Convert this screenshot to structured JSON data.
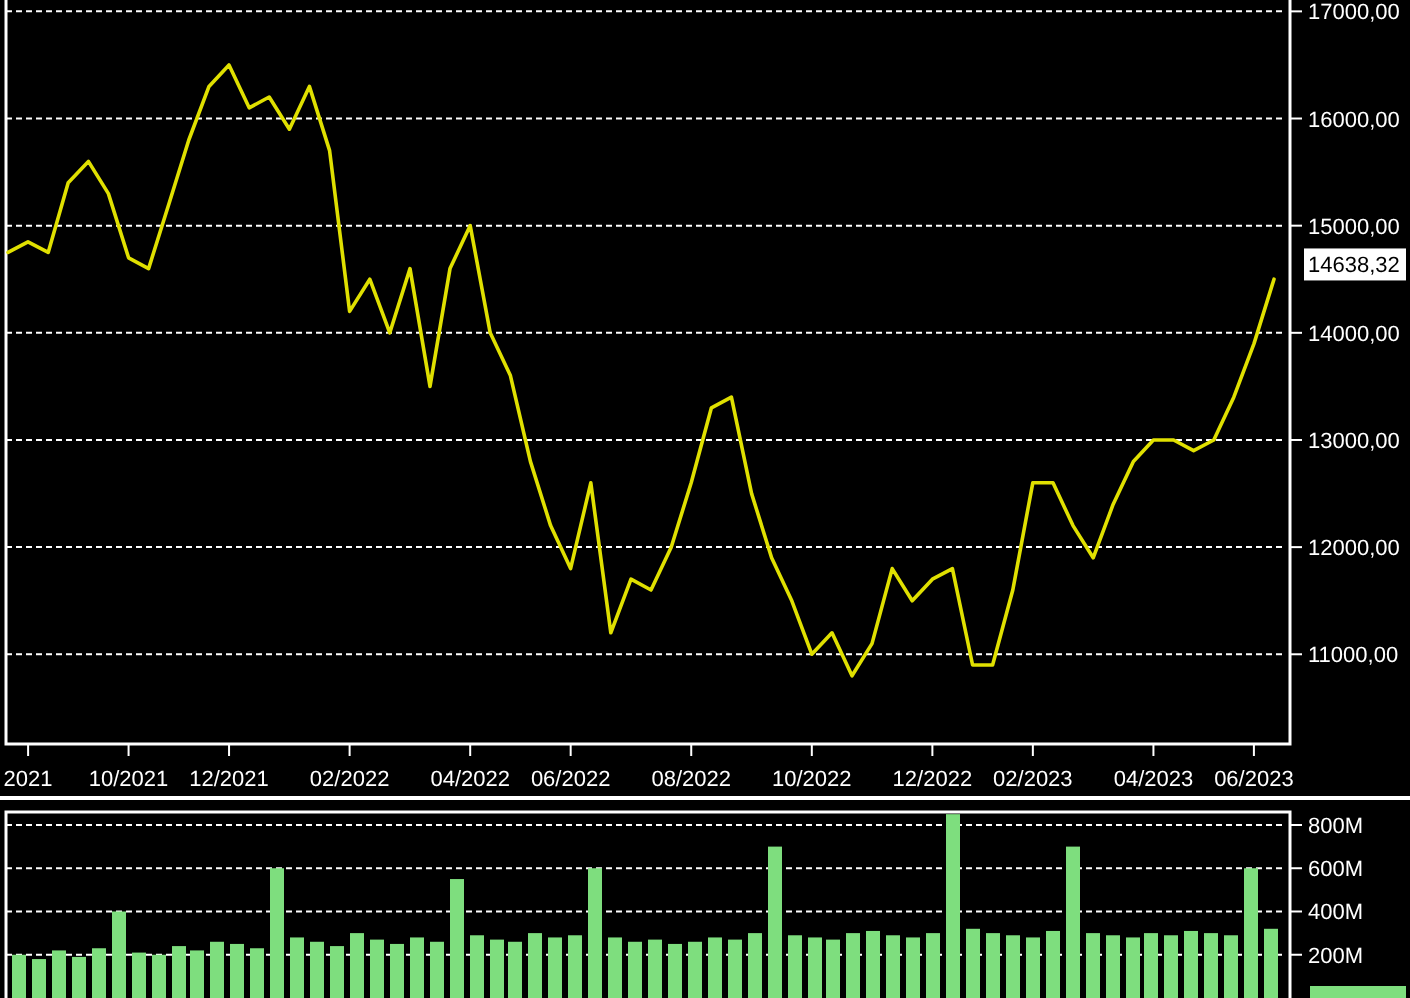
{
  "price_chart": {
    "chart_data": {
      "type": "line",
      "categories": [
        null,
        "2021",
        null,
        null,
        null,
        null,
        "10/2021",
        null,
        null,
        null,
        null,
        "12/2021",
        null,
        null,
        null,
        null,
        null,
        "02/2022",
        null,
        null,
        null,
        null,
        null,
        "04/2022",
        null,
        null,
        null,
        null,
        "06/2022",
        null,
        null,
        null,
        null,
        null,
        "08/2022",
        null,
        null,
        null,
        null,
        null,
        "10/2022",
        null,
        null,
        null,
        null,
        null,
        "12/2022",
        null,
        null,
        null,
        null,
        "02/2023",
        null,
        null,
        null,
        null,
        null,
        "04/2023",
        null,
        null,
        null,
        null,
        "06/2023",
        null
      ],
      "series": [
        {
          "color": "#e0e000",
          "values": [
            14750,
            14850,
            14750,
            15400,
            15600,
            15300,
            14700,
            14600,
            15200,
            15800,
            16300,
            16500,
            16100,
            16200,
            15900,
            16300,
            15700,
            14200,
            14500,
            14000,
            14600,
            13500,
            14600,
            15000,
            14000,
            13600,
            12800,
            12200,
            11800,
            12600,
            11200,
            11700,
            11600,
            12000,
            12600,
            13300,
            13400,
            12500,
            11900,
            11500,
            11000,
            11200,
            10800,
            11100,
            11800,
            11500,
            11700,
            11800,
            10900,
            10900,
            11600,
            12600,
            12600,
            12200,
            11900,
            12400,
            12800,
            13000,
            13000,
            12900,
            13000,
            13400,
            13900,
            14500
          ]
        }
      ],
      "ylim": [
        10200,
        17050
      ],
      "grid": true,
      "yticks": [
        {
          "value": 17000,
          "label": "17000,00"
        },
        {
          "value": 16000,
          "label": "16000,00"
        },
        {
          "value": 15000,
          "label": "15000,00"
        },
        {
          "value": 14000,
          "label": "14000,00"
        },
        {
          "value": 13000,
          "label": "13000,00"
        },
        {
          "value": 12000,
          "label": "12000,00"
        },
        {
          "value": 11000,
          "label": "11000,00"
        }
      ]
    },
    "last_price": "14638,32"
  },
  "volume_chart": {
    "chart_data": {
      "type": "bar",
      "grid": true,
      "series": [
        {
          "color": "#7ede7e",
          "values": [
            200,
            180,
            220,
            190,
            230,
            400,
            210,
            200,
            240,
            220,
            260,
            250,
            230,
            600,
            280,
            260,
            240,
            300,
            270,
            250,
            280,
            260,
            550,
            290,
            270,
            260,
            300,
            280,
            290,
            600,
            280,
            260,
            270,
            250,
            260,
            280,
            270,
            300,
            700,
            290,
            280,
            270,
            300,
            310,
            290,
            280,
            300,
            850,
            320,
            300,
            290,
            280,
            310,
            700,
            300,
            290,
            280,
            300,
            290,
            310,
            300,
            290,
            600,
            320
          ]
        }
      ],
      "ylim": [
        0,
        860
      ],
      "yticks": [
        {
          "value": 800,
          "label": "800M"
        },
        {
          "value": 600,
          "label": "600M"
        },
        {
          "value": 400,
          "label": "400M"
        },
        {
          "value": 200,
          "label": "200M"
        }
      ]
    }
  }
}
